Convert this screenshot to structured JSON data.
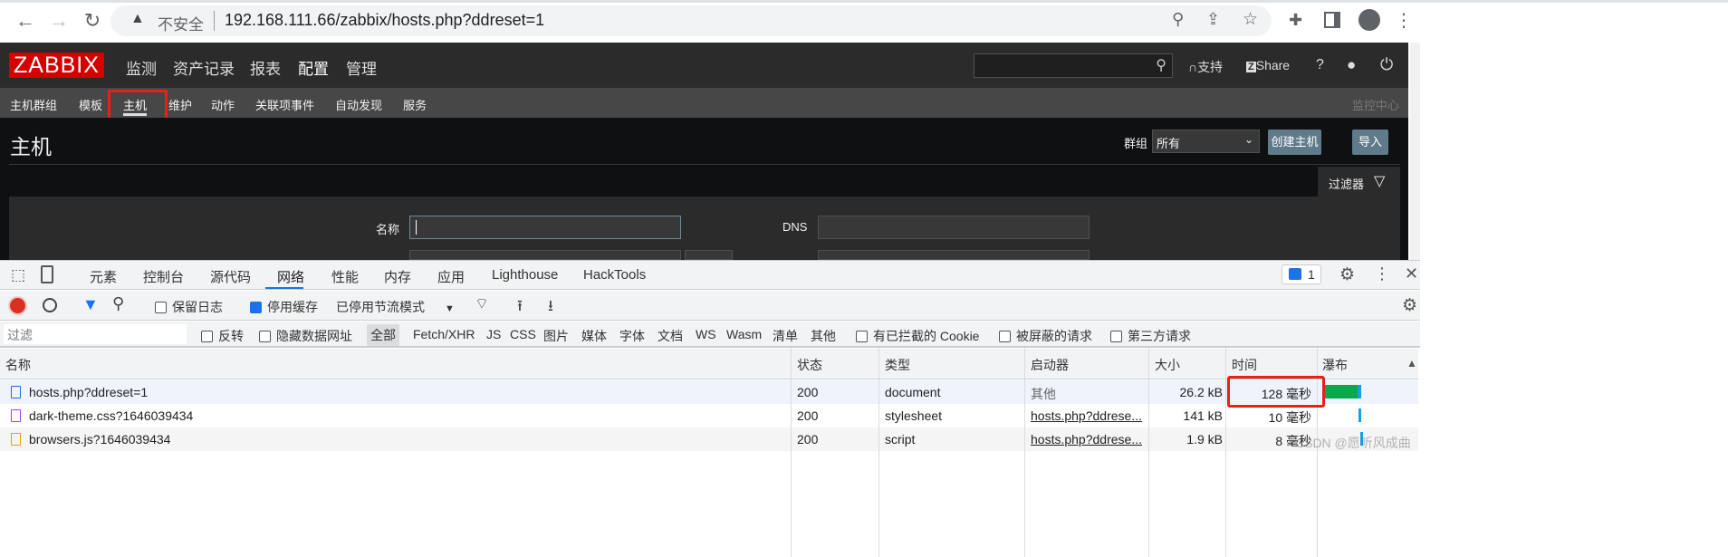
{
  "browser": {
    "security": "不安全",
    "url": "192.168.111.66/zabbix/hosts.php?ddreset=1"
  },
  "zabbix": {
    "logo": "ZABBIX",
    "main_menu": [
      "监测",
      "资产记录",
      "报表",
      "配置",
      "管理"
    ],
    "active_main": "配置",
    "sub_menu": [
      "主机群组",
      "模板",
      "主机",
      "维护",
      "动作",
      "关联项事件",
      "自动发现",
      "服务"
    ],
    "active_sub": "主机",
    "support": "支持",
    "share": "Share",
    "help": "?",
    "breadcrumb_right": "监控中心",
    "page_title": "主机",
    "group_label": "群组",
    "group_value": "所有",
    "create_button": "创建主机",
    "import_button": "导入",
    "filter_tab": "过滤器",
    "filter_name_label": "名称",
    "filter_dns_label": "DNS",
    "filter_name_value": ""
  },
  "devtools": {
    "tabs": [
      "元素",
      "控制台",
      "源代码",
      "网络",
      "性能",
      "内存",
      "应用",
      "Lighthouse",
      "HackTools"
    ],
    "active_tab": "网络",
    "issues_count": "1",
    "toolbar": {
      "preserve_log": "保留日志",
      "disable_cache": "停用缓存",
      "throttle": "已停用节流模式"
    },
    "filter_placeholder": "过滤",
    "filter_opts": {
      "invert": "反转",
      "hide_data_urls": "隐藏数据网址"
    },
    "types": [
      "全部",
      "Fetch/XHR",
      "JS",
      "CSS",
      "图片",
      "媒体",
      "字体",
      "文档",
      "WS",
      "Wasm",
      "清单",
      "其他"
    ],
    "extra_filters": [
      "有已拦截的 Cookie",
      "被屏蔽的请求",
      "第三方请求"
    ],
    "columns": [
      "名称",
      "状态",
      "类型",
      "启动器",
      "大小",
      "时间",
      "瀑布"
    ],
    "rows": [
      {
        "name": "hosts.php?ddreset=1",
        "status": "200",
        "type": "document",
        "initiator": "其他",
        "size": "26.2 kB",
        "time": "128 毫秒",
        "icon": "document-icon"
      },
      {
        "name": "dark-theme.css?1646039434",
        "status": "200",
        "type": "stylesheet",
        "initiator": "hosts.php?ddrese...",
        "size": "141 kB",
        "time": "10 毫秒",
        "icon": "stylesheet-icon"
      },
      {
        "name": "browsers.js?1646039434",
        "status": "200",
        "type": "script",
        "initiator": "hosts.php?ddrese...",
        "size": "1.9 kB",
        "time": "8 毫秒",
        "icon": "script-icon"
      }
    ]
  },
  "watermark": "CSDN @愿听风成曲",
  "colors": {
    "highlight": "#e8201a",
    "zabbix_red": "#d40000",
    "waterfall_green": "#0aa84a",
    "waterfall_blue": "#1a9de8"
  }
}
